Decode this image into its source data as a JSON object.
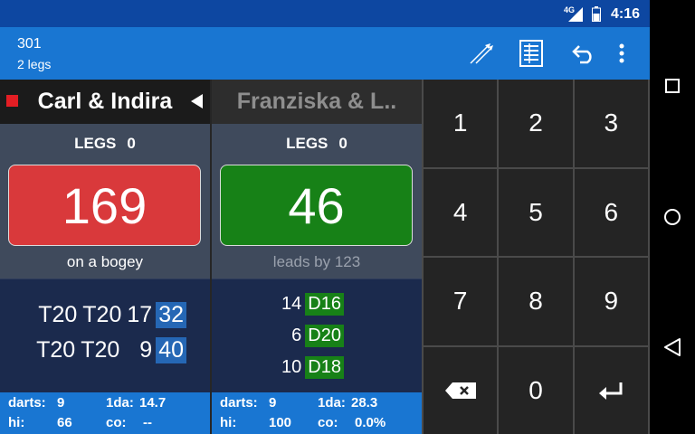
{
  "status_bar": {
    "network": "4G",
    "time": "4:16"
  },
  "app_bar": {
    "title": "301",
    "subtitle": "2 legs",
    "icons": [
      "darts-icon",
      "scoresheet-icon",
      "undo-icon",
      "more-vert-icon"
    ]
  },
  "players": [
    {
      "name": "Carl & Indira",
      "active": true,
      "legs_label": "LEGS",
      "legs": "0",
      "score": "169",
      "status": "on a bogey",
      "checkouts": [
        {
          "darts": [
            "T20",
            "T20",
            "17"
          ],
          "final": "32"
        },
        {
          "darts": [
            "T20",
            "T20",
            "9"
          ],
          "final": "40"
        }
      ],
      "stats": {
        "darts_label": "darts:",
        "darts": "9",
        "first_label": "1da:",
        "first": "14.7",
        "hi_label": "hi:",
        "hi": "66",
        "co_label": "co:",
        "co": "--"
      }
    },
    {
      "name": "Franziska & L..",
      "active": false,
      "legs_label": "LEGS",
      "legs": "0",
      "score": "46",
      "status": "leads by 123",
      "checkouts": [
        {
          "darts": [
            "14"
          ],
          "final": "D16"
        },
        {
          "darts": [
            "6"
          ],
          "final": "D20"
        },
        {
          "darts": [
            "10"
          ],
          "final": "D18"
        }
      ],
      "stats": {
        "darts_label": "darts:",
        "darts": "9",
        "first_label": "1da:",
        "first": "28.3",
        "hi_label": "hi:",
        "hi": "100",
        "co_label": "co:",
        "co": "0.0%"
      }
    }
  ],
  "keypad": {
    "keys": [
      "1",
      "2",
      "3",
      "4",
      "5",
      "6",
      "7",
      "8",
      "9"
    ],
    "zero": "0"
  },
  "colors": {
    "bust_red": "#d9393b",
    "lead_green": "#178117",
    "accent_blue": "#1976d2"
  }
}
